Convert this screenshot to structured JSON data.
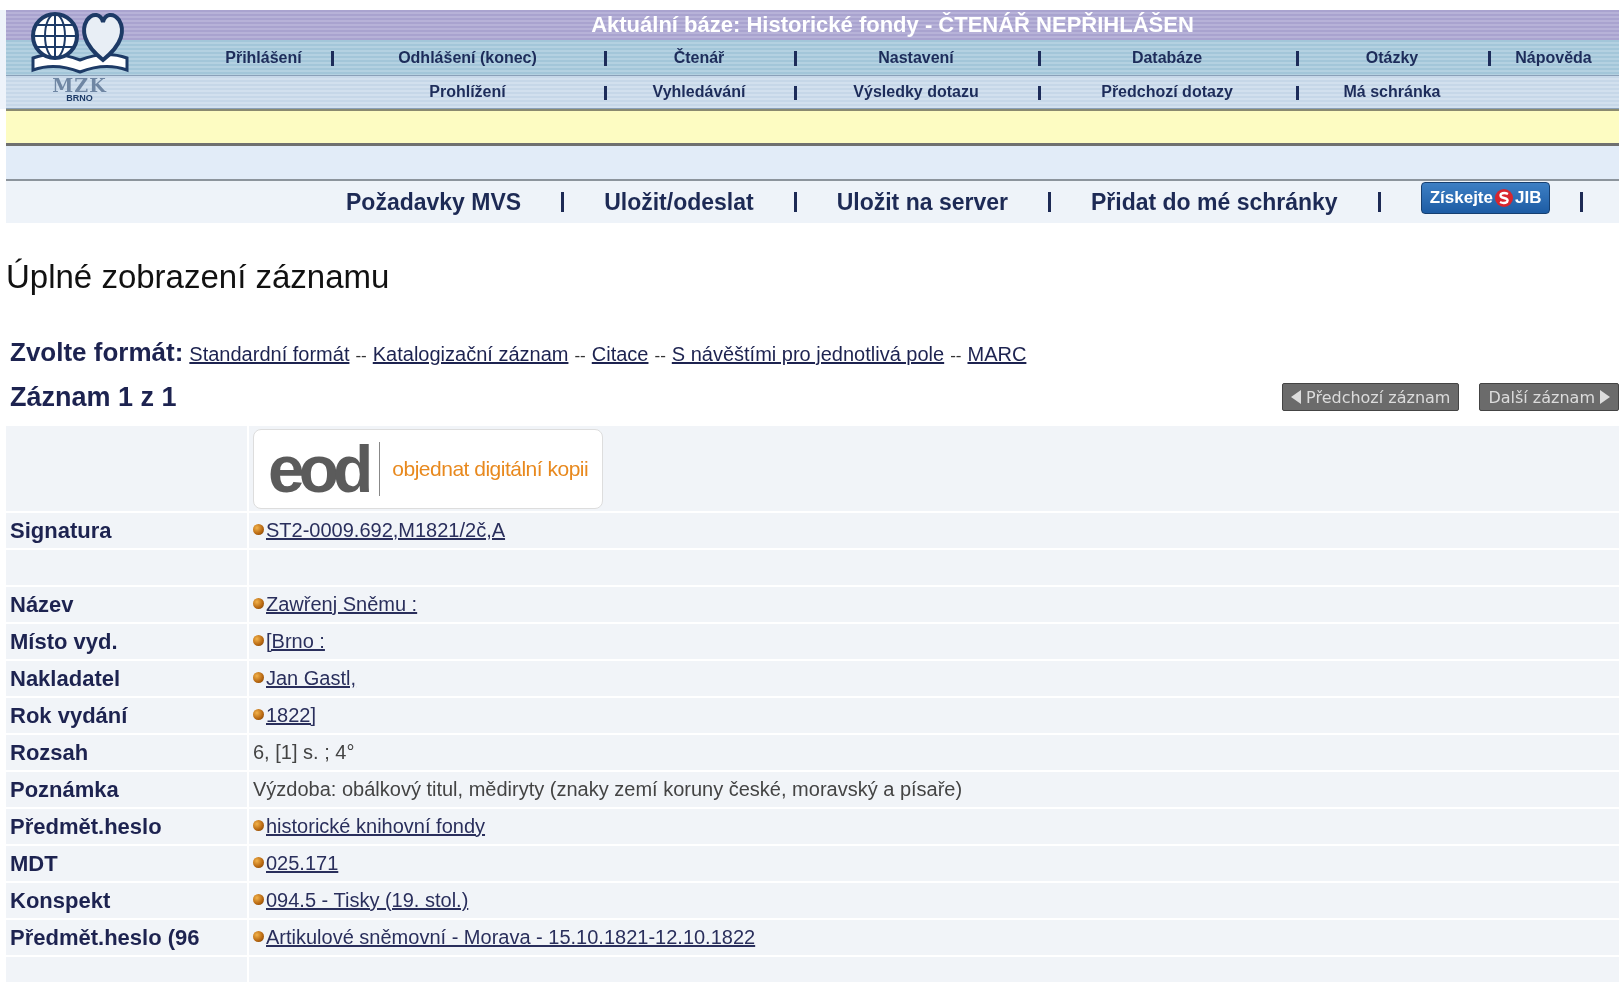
{
  "header": {
    "logo": {
      "name": "MZK",
      "city": "BRNO"
    },
    "title": "Aktuální báze: Historické fondy - ČTENÁŘ NEPŘIHLÁŠEN",
    "menu_primary": [
      "Přihlášení",
      "Odhlášení (konec)",
      "Čtenář",
      "Nastavení",
      "Databáze",
      "Otázky",
      "Nápověda"
    ],
    "menu_secondary": [
      "Prohlížení",
      "Vyhledávání",
      "Výsledky dotazu",
      "Předchozí dotazy",
      "Má schránka"
    ]
  },
  "actions": [
    {
      "kind": "link",
      "label": "Požadavky MVS"
    },
    {
      "kind": "link",
      "label": "Uložit/odeslat"
    },
    {
      "kind": "link",
      "label": "Uložit na server"
    },
    {
      "kind": "link",
      "label": "Přidat do mé schránky"
    },
    {
      "kind": "badge",
      "label": "Získejte",
      "brand": "JIB"
    }
  ],
  "heading": "Úplné zobrazení záznamu",
  "formats": {
    "label": "Zvolte formát:",
    "items": [
      {
        "kind": "link",
        "text": "Standardní formát"
      },
      {
        "kind": "sep",
        "text": "--"
      },
      {
        "kind": "link",
        "text": "Katalogizační záznam"
      },
      {
        "kind": "sep",
        "text": "--"
      },
      {
        "kind": "link",
        "text": "Citace"
      },
      {
        "kind": "sep",
        "text": "--"
      },
      {
        "kind": "link",
        "text": "S návěštími pro jednotlivá pole"
      },
      {
        "kind": "sep",
        "text": "--"
      },
      {
        "kind": "link",
        "text": "MARC"
      }
    ]
  },
  "record_counter": "Záznam 1 z 1",
  "pager": {
    "previous": "Předchozí záznam",
    "next": "Další záznam"
  },
  "record": [
    {
      "kind": "eod",
      "logo": "eod",
      "text": "objednat digitální kopii"
    },
    {
      "kind": "link",
      "label": "Signatura",
      "value": "ST2-0009.692,M1821/2č,A"
    },
    {
      "kind": "spacer"
    },
    {
      "kind": "link",
      "label": "Název",
      "value": "Zawřenj Sněmu :"
    },
    {
      "kind": "link",
      "label": "Místo vyd.",
      "value": "[Brno :"
    },
    {
      "kind": "link",
      "label": "Nakladatel",
      "value": "Jan Gastl,"
    },
    {
      "kind": "link",
      "label": "Rok vydání",
      "value": "1822]"
    },
    {
      "kind": "text",
      "label": "Rozsah",
      "value": "6, [1] s. ; 4°"
    },
    {
      "kind": "text",
      "label": "Poznámka",
      "value": "Výzdoba: obálkový titul, mědiryty (znaky zemí koruny české, moravský a písaře)"
    },
    {
      "kind": "link",
      "label": "Předmět.heslo",
      "value": "historické knihovní fondy"
    },
    {
      "kind": "link",
      "label": "MDT",
      "value": "025.171"
    },
    {
      "kind": "link",
      "label": "Konspekt",
      "value": "094.5 - Tisky (19. stol.)"
    },
    {
      "kind": "link",
      "label": "Předmět.heslo (96",
      "value": "Artikulové sněmovní - Morava - 15.10.1821-12.10.1822"
    },
    {
      "kind": "spacer"
    }
  ]
}
